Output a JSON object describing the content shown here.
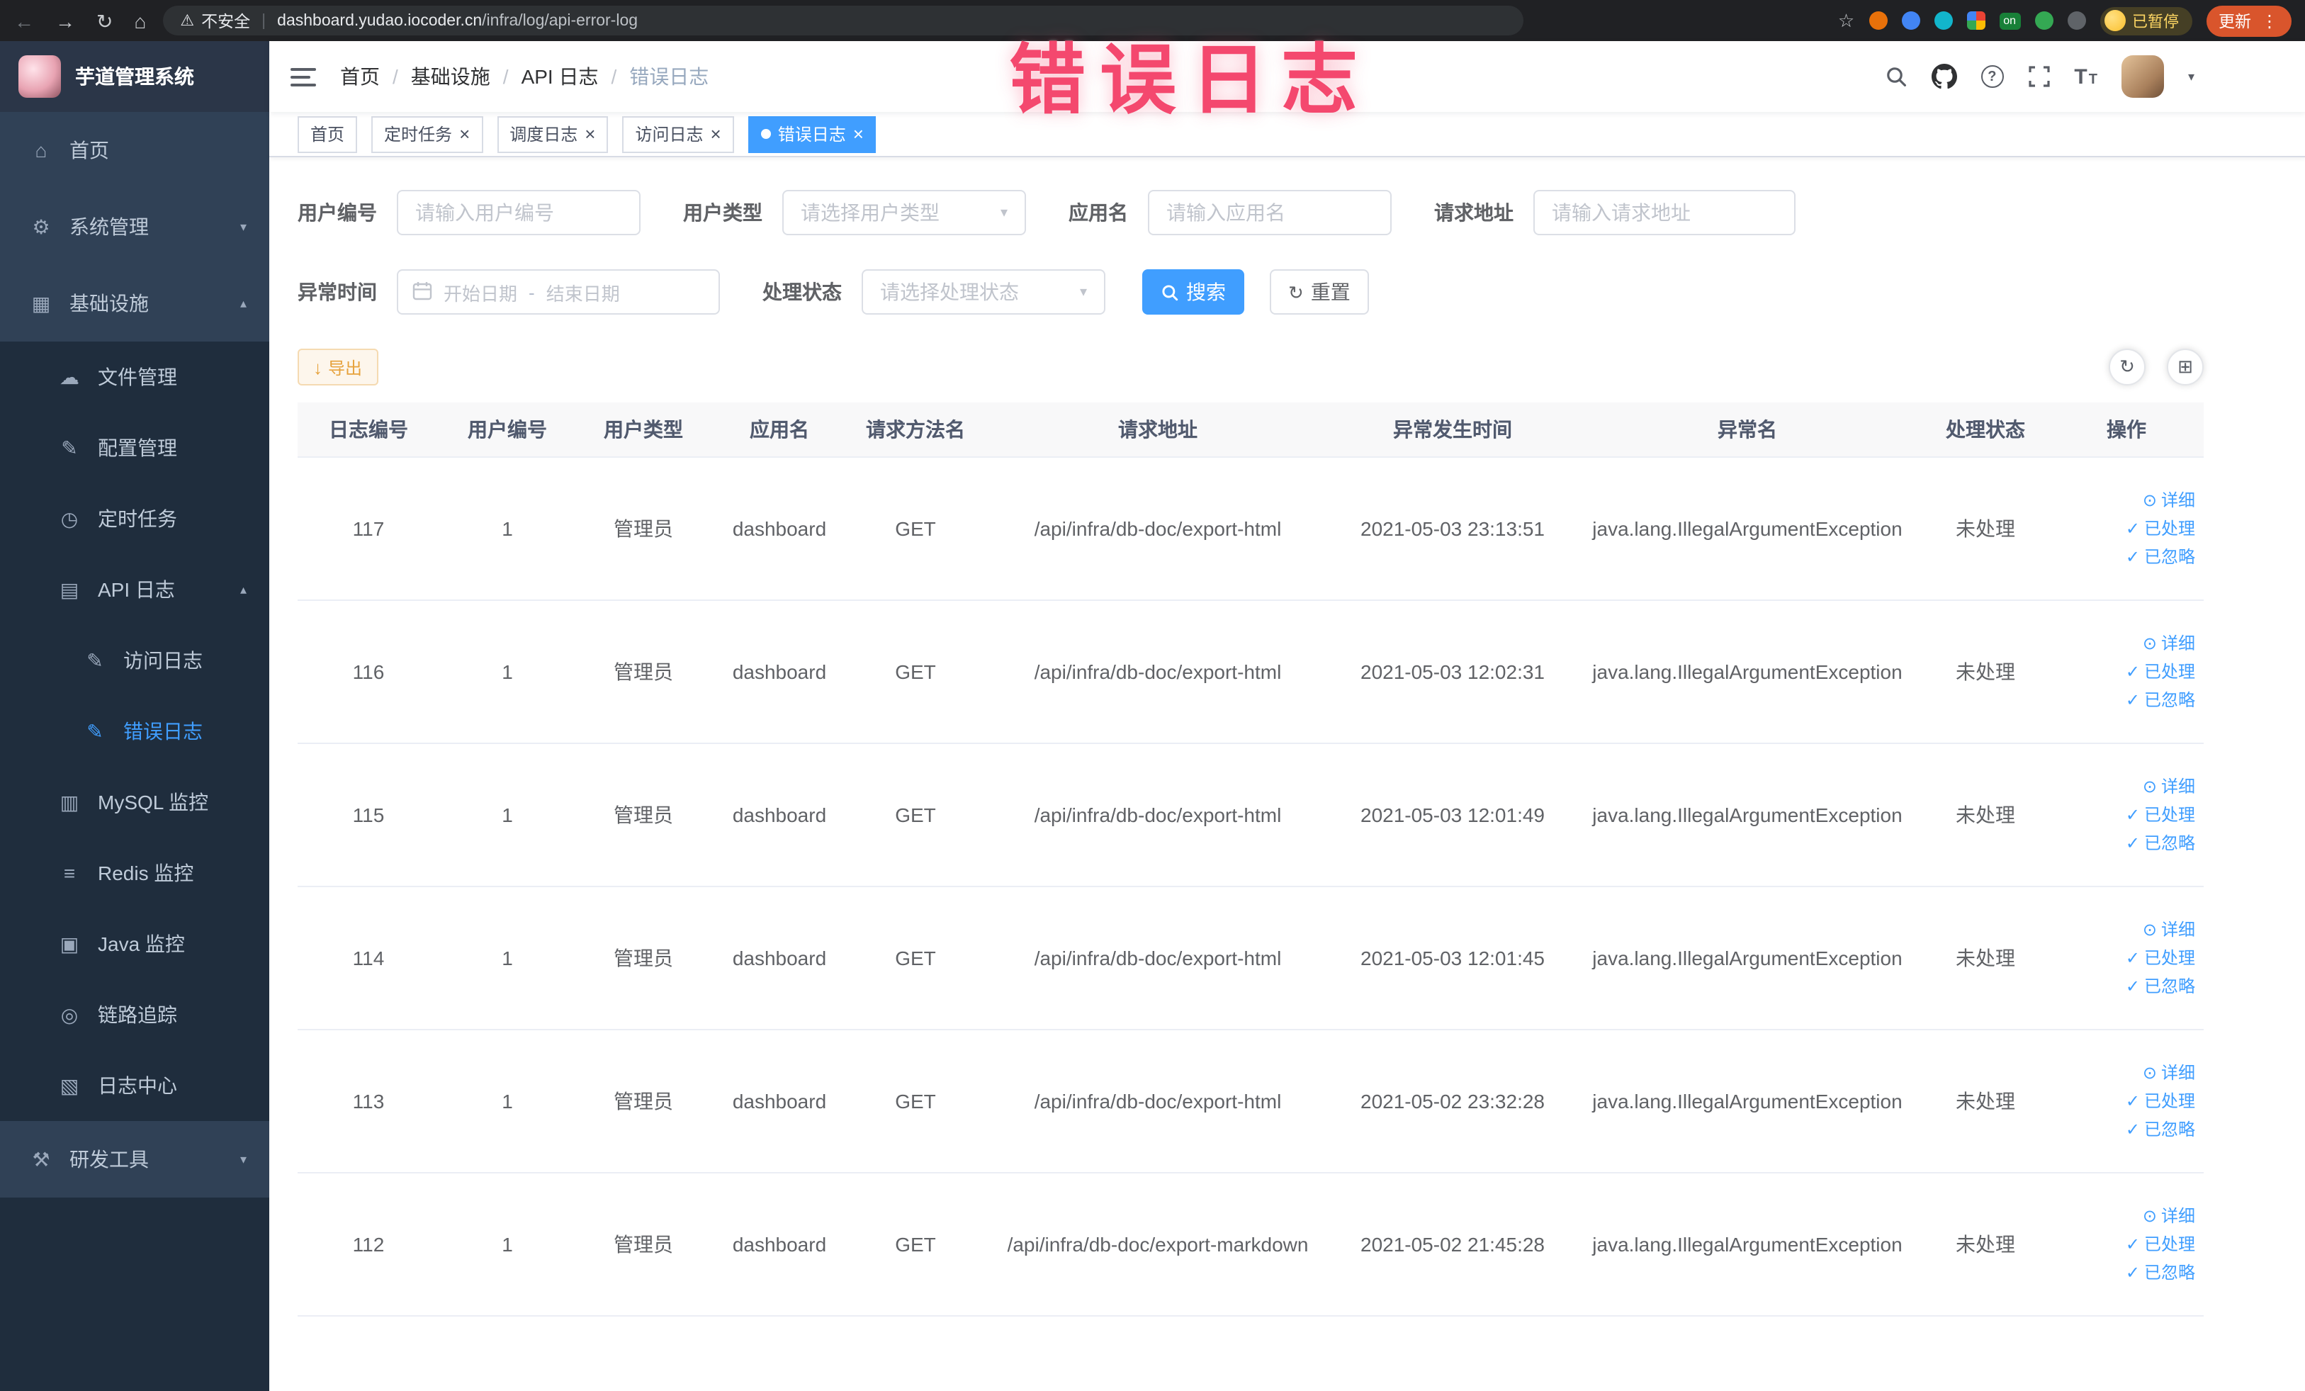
{
  "colors": {
    "accent_blue": "#409EFF",
    "sidebar_bg": "#304156",
    "sidebar_submenu_bg": "#1f2d3d",
    "annotation_pink": "#f4486e",
    "warning_orange": "#e6a23c",
    "update_button_red": "#d9552c",
    "paused_badge_yellow": "#fdd663",
    "table_header_bg": "#f8f8f9"
  },
  "icons": {
    "back": "←",
    "forward": "→",
    "reload": "↻",
    "home": "⌂",
    "warning": "⚠",
    "pipe": "|",
    "star": "☆",
    "kebab": "⋮",
    "caret_down": "▾",
    "caret_up": "▴",
    "close": "×",
    "question": "?",
    "check": "✓",
    "eye": "⊙",
    "refresh": "↻",
    "download": "↓",
    "grid": "⊞",
    "font_size": "T"
  },
  "browser": {
    "security_label": "不安全",
    "url_domain": "dashboard.yudao.iocoder.cn",
    "url_path": "/infra/log/api-error-log",
    "extension_badge_on": "on",
    "paused_badge": "已暂停",
    "update_button": "更新"
  },
  "annotation": {
    "text": "错误日志"
  },
  "sidebar": {
    "logo_title": "芋道管理系统",
    "items": [
      {
        "label": "首页",
        "glyph": "⌂"
      },
      {
        "label": "系统管理",
        "glyph": "⚙"
      },
      {
        "label": "基础设施",
        "glyph": "▦"
      },
      {
        "label": "文件管理",
        "glyph": "☁"
      },
      {
        "label": "配置管理",
        "glyph": "✎"
      },
      {
        "label": "定时任务",
        "glyph": "◷"
      },
      {
        "label": "API 日志",
        "glyph": "▤"
      },
      {
        "label": "访问日志",
        "glyph": "✎"
      },
      {
        "label": "错误日志",
        "glyph": "✎"
      },
      {
        "label": "MySQL 监控",
        "glyph": "▥"
      },
      {
        "label": "Redis 监控",
        "glyph": "≡"
      },
      {
        "label": "Java 监控",
        "glyph": "▣"
      },
      {
        "label": "链路追踪",
        "glyph": "◎"
      },
      {
        "label": "日志中心",
        "glyph": "▧"
      },
      {
        "label": "研发工具",
        "glyph": "⚒"
      }
    ]
  },
  "navbar": {
    "breadcrumb_separator": "/",
    "breadcrumb": [
      {
        "label": "首页"
      },
      {
        "label": "基础设施"
      },
      {
        "label": "API 日志"
      },
      {
        "label": "错误日志"
      }
    ]
  },
  "tags": [
    {
      "label": "首页"
    },
    {
      "label": "定时任务"
    },
    {
      "label": "调度日志"
    },
    {
      "label": "访问日志"
    },
    {
      "label": "错误日志"
    }
  ],
  "filters": {
    "user_id": {
      "label": "用户编号",
      "placeholder": "请输入用户编号"
    },
    "user_type": {
      "label": "用户类型",
      "placeholder": "请选择用户类型"
    },
    "app_name": {
      "label": "应用名",
      "placeholder": "请输入应用名"
    },
    "request_url": {
      "label": "请求地址",
      "placeholder": "请输入请求地址"
    },
    "exception_time": {
      "label": "异常时间",
      "start_placeholder": "开始日期",
      "separator": "-",
      "end_placeholder": "结束日期"
    },
    "process_status": {
      "label": "处理状态",
      "placeholder": "请选择处理状态"
    },
    "search_button": "搜索",
    "reset_button": "重置"
  },
  "toolbar": {
    "export_button": "导出"
  },
  "table": {
    "headers": [
      "日志编号",
      "用户编号",
      "用户类型",
      "应用名",
      "请求方法名",
      "请求地址",
      "异常发生时间",
      "异常名",
      "处理状态",
      "操作"
    ],
    "action_labels": {
      "detail": "详细",
      "processed": "已处理",
      "ignored": "已忽略"
    },
    "rows": [
      {
        "log_id": "117",
        "user_id": "1",
        "user_type": "管理员",
        "app_name": "dashboard",
        "method": "GET",
        "request_url": "/api/infra/db-doc/export-html",
        "time": "2021-05-03 23:13:51",
        "exception": "java.lang.IllegalArgumentException",
        "status": "未处理"
      },
      {
        "log_id": "116",
        "user_id": "1",
        "user_type": "管理员",
        "app_name": "dashboard",
        "method": "GET",
        "request_url": "/api/infra/db-doc/export-html",
        "time": "2021-05-03 12:02:31",
        "exception": "java.lang.IllegalArgumentException",
        "status": "未处理"
      },
      {
        "log_id": "115",
        "user_id": "1",
        "user_type": "管理员",
        "app_name": "dashboard",
        "method": "GET",
        "request_url": "/api/infra/db-doc/export-html",
        "time": "2021-05-03 12:01:49",
        "exception": "java.lang.IllegalArgumentException",
        "status": "未处理"
      },
      {
        "log_id": "114",
        "user_id": "1",
        "user_type": "管理员",
        "app_name": "dashboard",
        "method": "GET",
        "request_url": "/api/infra/db-doc/export-html",
        "time": "2021-05-03 12:01:45",
        "exception": "java.lang.IllegalArgumentException",
        "status": "未处理"
      },
      {
        "log_id": "113",
        "user_id": "1",
        "user_type": "管理员",
        "app_name": "dashboard",
        "method": "GET",
        "request_url": "/api/infra/db-doc/export-html",
        "time": "2021-05-02 23:32:28",
        "exception": "java.lang.IllegalArgumentException",
        "status": "未处理"
      },
      {
        "log_id": "112",
        "user_id": "1",
        "user_type": "管理员",
        "app_name": "dashboard",
        "method": "GET",
        "request_url": "/api/infra/db-doc/export-markdown",
        "time": "2021-05-02 21:45:28",
        "exception": "java.lang.IllegalArgumentException",
        "status": "未处理"
      }
    ]
  }
}
